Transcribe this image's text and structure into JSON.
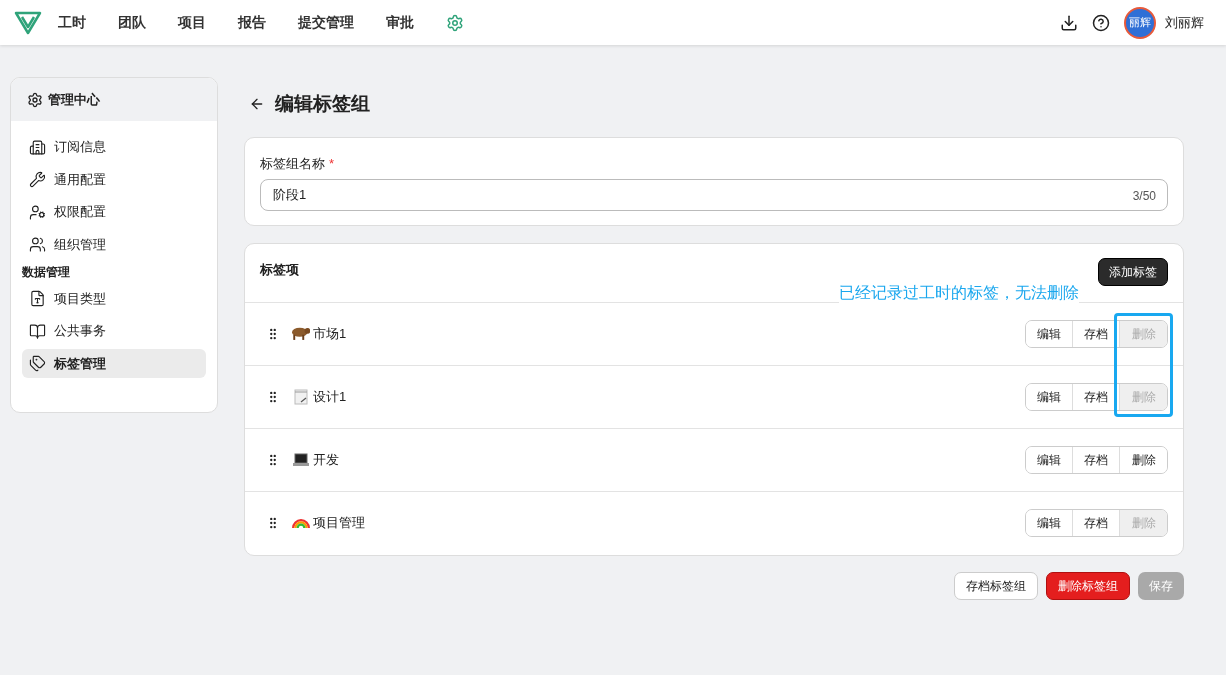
{
  "nav": {
    "items": [
      {
        "label": "工时",
        "selected": false
      },
      {
        "label": "团队",
        "selected": false
      },
      {
        "label": "项目",
        "selected": false
      },
      {
        "label": "报告",
        "selected": false
      },
      {
        "label": "提交管理",
        "selected": false
      },
      {
        "label": "审批",
        "selected": false
      }
    ],
    "settings_selected": true,
    "user": "刘丽辉",
    "avatar_text": "丽辉"
  },
  "sidebar": {
    "title": "管理中心",
    "groups": [
      {
        "items": [
          {
            "label": "订阅信息",
            "kind": "building",
            "selected": false
          },
          {
            "label": "通用配置",
            "kind": "wrench",
            "selected": false
          },
          {
            "label": "权限配置",
            "kind": "usergear",
            "selected": false
          },
          {
            "label": "组织管理",
            "kind": "users",
            "selected": false
          }
        ]
      },
      {
        "heading": "数据管理",
        "items": [
          {
            "label": "项目类型",
            "kind": "file",
            "selected": false
          },
          {
            "label": "公共事务",
            "kind": "book",
            "selected": false
          },
          {
            "label": "标签管理",
            "kind": "tag",
            "selected": true
          }
        ]
      }
    ]
  },
  "page": {
    "title": "编辑标签组"
  },
  "name_field": {
    "label": "标签组名称",
    "required_mark": "*",
    "value": "阶段1",
    "counter": "3/50"
  },
  "tags": {
    "title": "标签项",
    "add_button": "添加标签",
    "annotation": "已经记录过工时的标签，无法删除",
    "items": [
      {
        "name": "市场1",
        "kind": "ox",
        "edit": "编辑",
        "archive": "存档",
        "delete": "删除",
        "delete_disabled": true
      },
      {
        "name": "设计1",
        "kind": "notepad",
        "edit": "编辑",
        "archive": "存档",
        "delete": "删除",
        "delete_disabled": true
      },
      {
        "name": "开发",
        "kind": "laptop",
        "edit": "编辑",
        "archive": "存档",
        "delete": "删除",
        "delete_disabled": false
      },
      {
        "name": "项目管理",
        "kind": "rainbow",
        "edit": "编辑",
        "archive": "存档",
        "delete": "删除",
        "delete_disabled": true
      }
    ]
  },
  "footer": {
    "archive": "存档标签组",
    "delete": "删除标签组",
    "save": "保存",
    "save_disabled": true
  }
}
